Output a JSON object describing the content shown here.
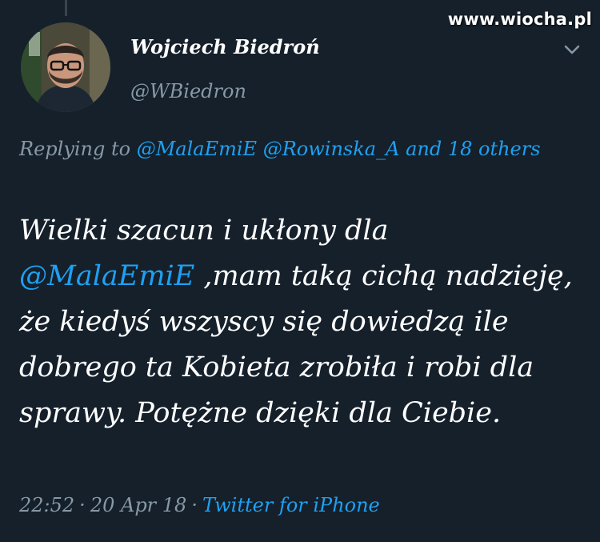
{
  "watermark": "www.wiocha.pl",
  "author": {
    "display_name": "Wojciech Biedroń",
    "handle": "@WBiedron"
  },
  "reply": {
    "prefix": "Replying to",
    "mention_1": "@MalaEmiE",
    "mention_2": "@Rowinska_A",
    "others": "and 18 others"
  },
  "tweet": {
    "line_1": "Wielki szacun i ukłony dla",
    "mention": "@MalaEmiE",
    "rest": " ,mam taką cichą nadzieję, że kiedyś wszyscy się dowiedzą ile dobrego ta Kobieta zrobiła i robi dla sprawy. Potężne dzięki dla Ciebie."
  },
  "meta": {
    "time": "22:52",
    "date": "20 Apr 18",
    "separator": "·",
    "source": "Twitter for iPhone"
  },
  "colors": {
    "background": "#15202b",
    "text": "#ffffff",
    "secondary": "#8899a6",
    "link": "#1da1f2"
  },
  "icons": {
    "menu": "chevron-down-icon"
  }
}
